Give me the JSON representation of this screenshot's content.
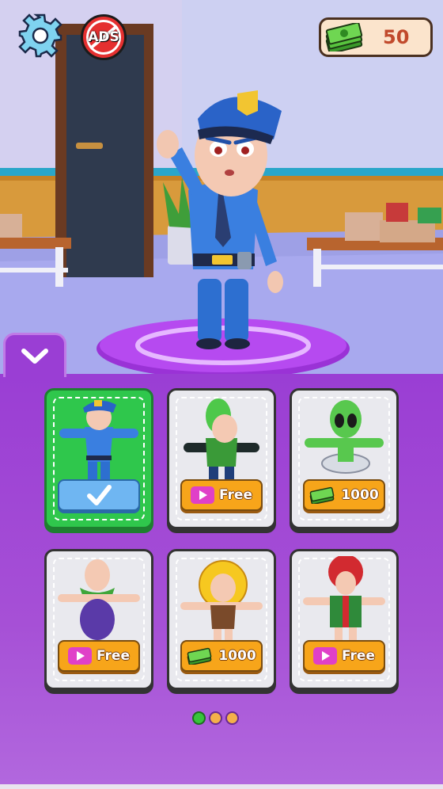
{
  "hud": {
    "settings_icon": "gear-icon",
    "no_ads_label": "ADS",
    "money_icon": "cash-stack-icon",
    "money_value": "50"
  },
  "panel": {
    "collapse_icon": "chevron-down-icon"
  },
  "skins": [
    {
      "name": "police-officer",
      "state": "selected",
      "action_icon": "checkmark-icon",
      "label": ""
    },
    {
      "name": "alien-costume-kid",
      "state": "locked",
      "action_icon": "video-play-icon",
      "label": "Free"
    },
    {
      "name": "alien-ufo",
      "state": "locked",
      "action_icon": "cash-stack-icon",
      "label": "1000"
    },
    {
      "name": "grape-costume",
      "state": "locked",
      "action_icon": "video-play-icon",
      "label": "Free"
    },
    {
      "name": "sunflower-costume",
      "state": "locked",
      "action_icon": "cash-stack-icon",
      "label": "1000"
    },
    {
      "name": "rose-gift-costume",
      "state": "locked",
      "action_icon": "video-play-icon",
      "label": "Free"
    }
  ],
  "pagination": {
    "pages": 3,
    "current": 1
  },
  "colors": {
    "panel": "#9a3ed4",
    "selected_card": "#2fc74c",
    "buy_button": "#f7a51a",
    "money_text": "#c14a2c"
  }
}
